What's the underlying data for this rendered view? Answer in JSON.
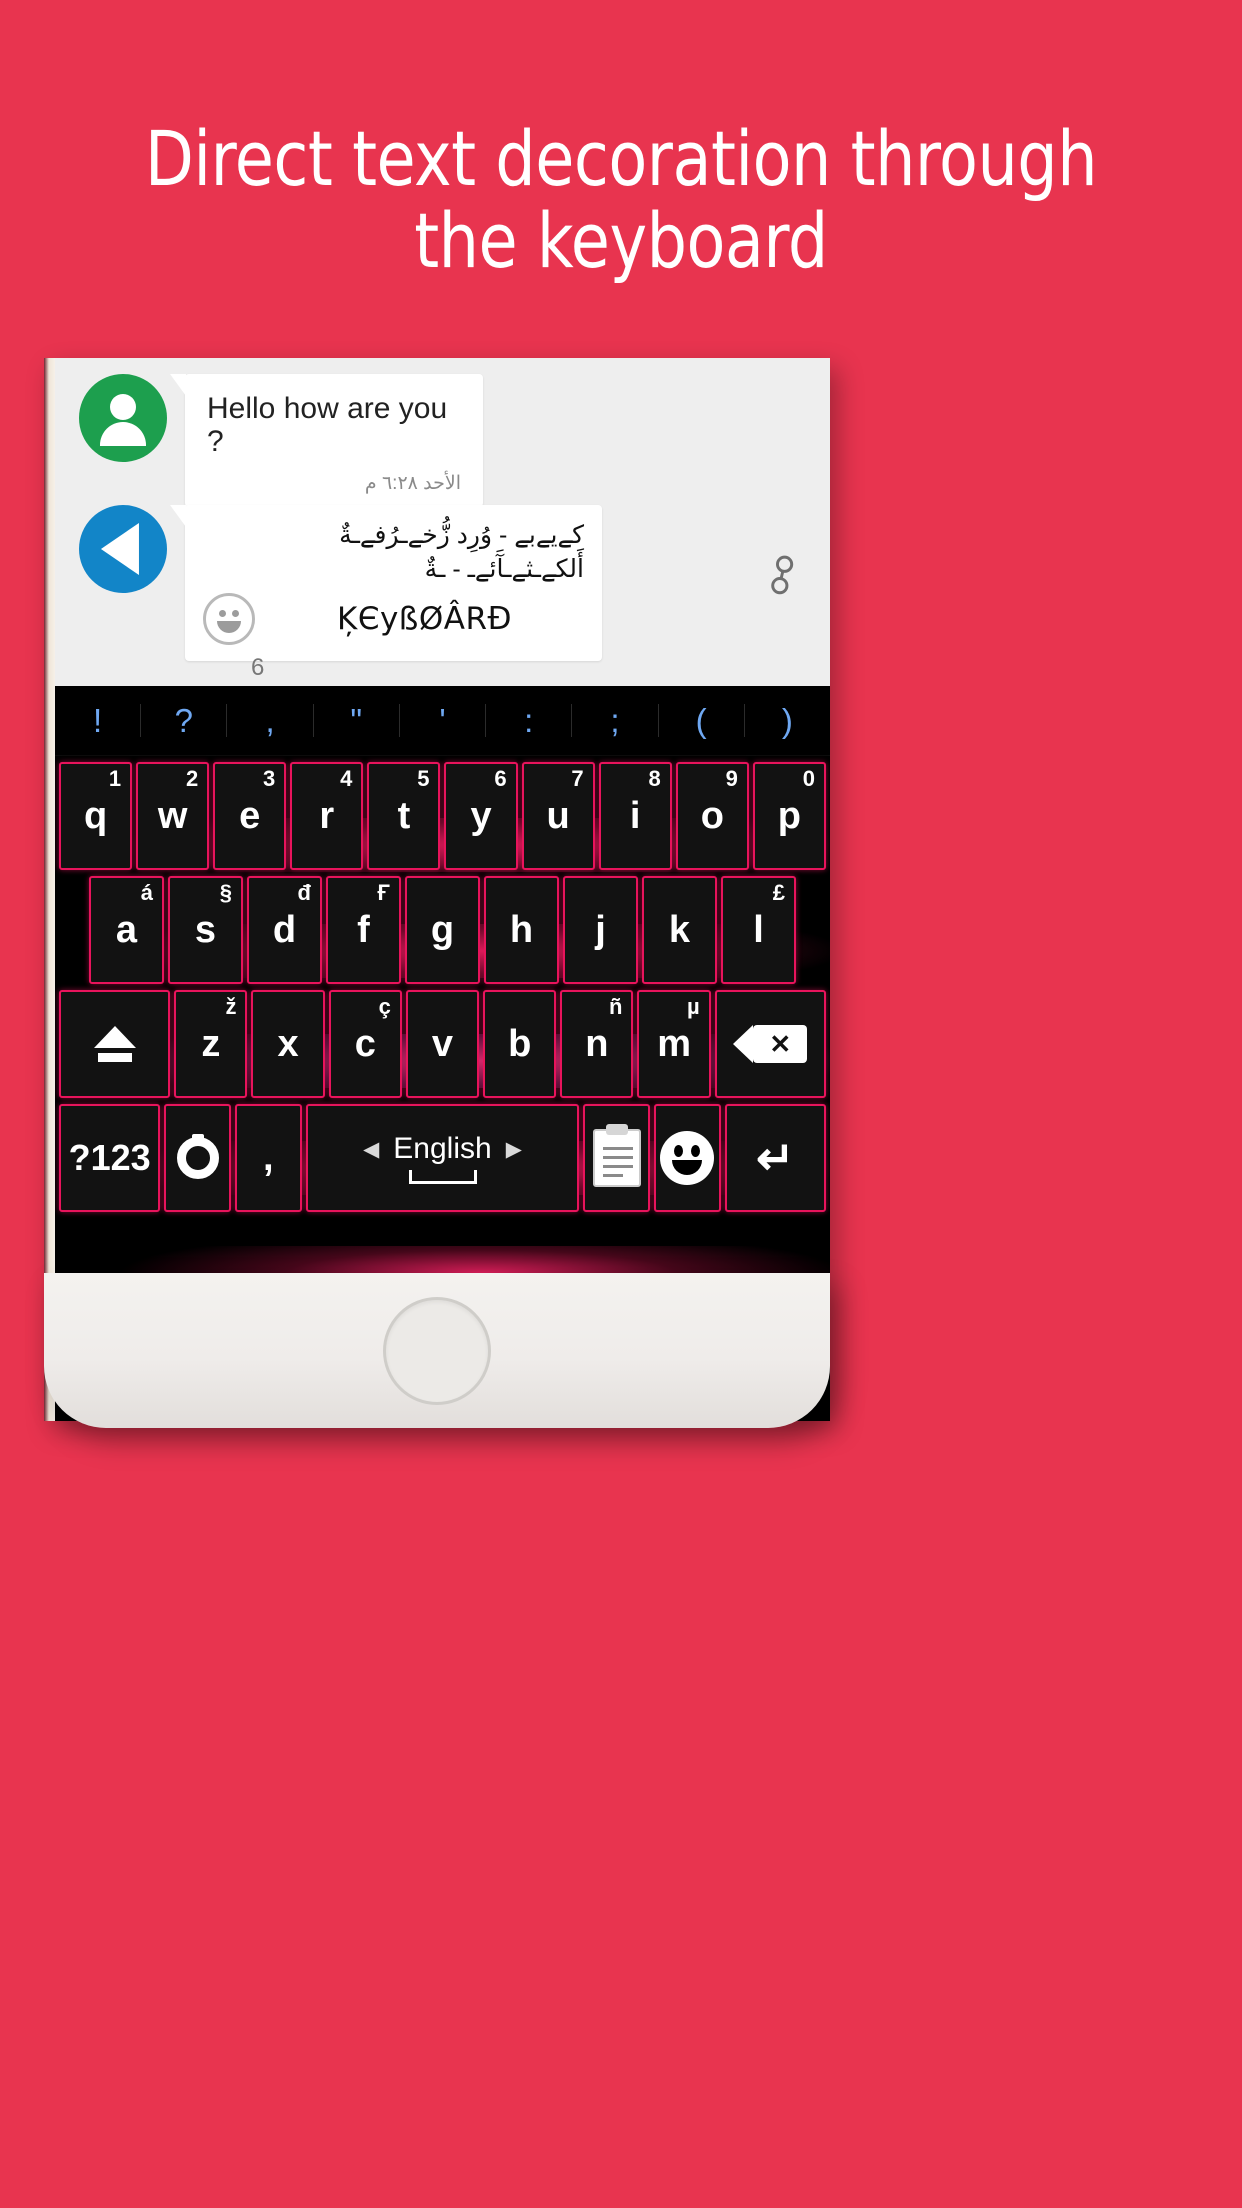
{
  "headline": {
    "line1": "Direct text decoration through",
    "line2": "the keyboard"
  },
  "colors": {
    "background": "#e8344f",
    "key_border": "#e8145c",
    "key_face": "#121212",
    "avatar_green": "#1d9f4e",
    "avatar_blue": "#1285c8",
    "punct_text": "#6fa8f2"
  },
  "chat": {
    "messages": [
      {
        "avatar": "contact-avatar",
        "text": "Hello how are you ?",
        "time": "الأحد ٦:٢٨ م"
      },
      {
        "avatar": "send-avatar",
        "deco_line1": "کےیےبے - وُرِد زُّخےـرُفےـةٌ",
        "deco_line2": "أَلکےـثےـآَئےـ - ـةٌ",
        "word": "ĶЄyßØÂRĐ"
      }
    ],
    "char_count": "6",
    "attach_icon": "paperclip-icon",
    "emoji_icon": "emoji-icon"
  },
  "keyboard": {
    "punctuation": [
      "!",
      "?",
      ",",
      "\"",
      "'",
      ":",
      ";",
      "(",
      ")"
    ],
    "row1": [
      {
        "key": "q",
        "sup": "1"
      },
      {
        "key": "w",
        "sup": "2"
      },
      {
        "key": "e",
        "sup": "3"
      },
      {
        "key": "r",
        "sup": "4"
      },
      {
        "key": "t",
        "sup": "5"
      },
      {
        "key": "y",
        "sup": "6"
      },
      {
        "key": "u",
        "sup": "7"
      },
      {
        "key": "i",
        "sup": "8"
      },
      {
        "key": "o",
        "sup": "9"
      },
      {
        "key": "p",
        "sup": "0"
      }
    ],
    "row2": [
      {
        "key": "a",
        "sup": "á"
      },
      {
        "key": "s",
        "sup": "§"
      },
      {
        "key": "d",
        "sup": "đ"
      },
      {
        "key": "f",
        "sup": "Ғ"
      },
      {
        "key": "g",
        "sup": ""
      },
      {
        "key": "h",
        "sup": ""
      },
      {
        "key": "j",
        "sup": ""
      },
      {
        "key": "k",
        "sup": ""
      },
      {
        "key": "l",
        "sup": "£"
      }
    ],
    "row3": [
      {
        "key": "z",
        "sup": "ž"
      },
      {
        "key": "x",
        "sup": ""
      },
      {
        "key": "c",
        "sup": "ç"
      },
      {
        "key": "v",
        "sup": ""
      },
      {
        "key": "b",
        "sup": ""
      },
      {
        "key": "n",
        "sup": "ñ"
      },
      {
        "key": "m",
        "sup": "µ"
      }
    ],
    "shift_key": "shift-key",
    "backspace_key": "backspace-key",
    "row4": {
      "symbols_label": "?123",
      "settings_label": "settings-key",
      "comma_label": ",",
      "space_label": "English",
      "space_prev": "◀",
      "space_next": "▶",
      "clipboard_label": "clipboard-key",
      "emoji_label": "emoji-key",
      "enter_label": "↵"
    }
  },
  "navbar": {
    "items": [
      "keyboard-switch-icon",
      "recents-icon",
      "home-icon",
      "back-icon"
    ]
  }
}
